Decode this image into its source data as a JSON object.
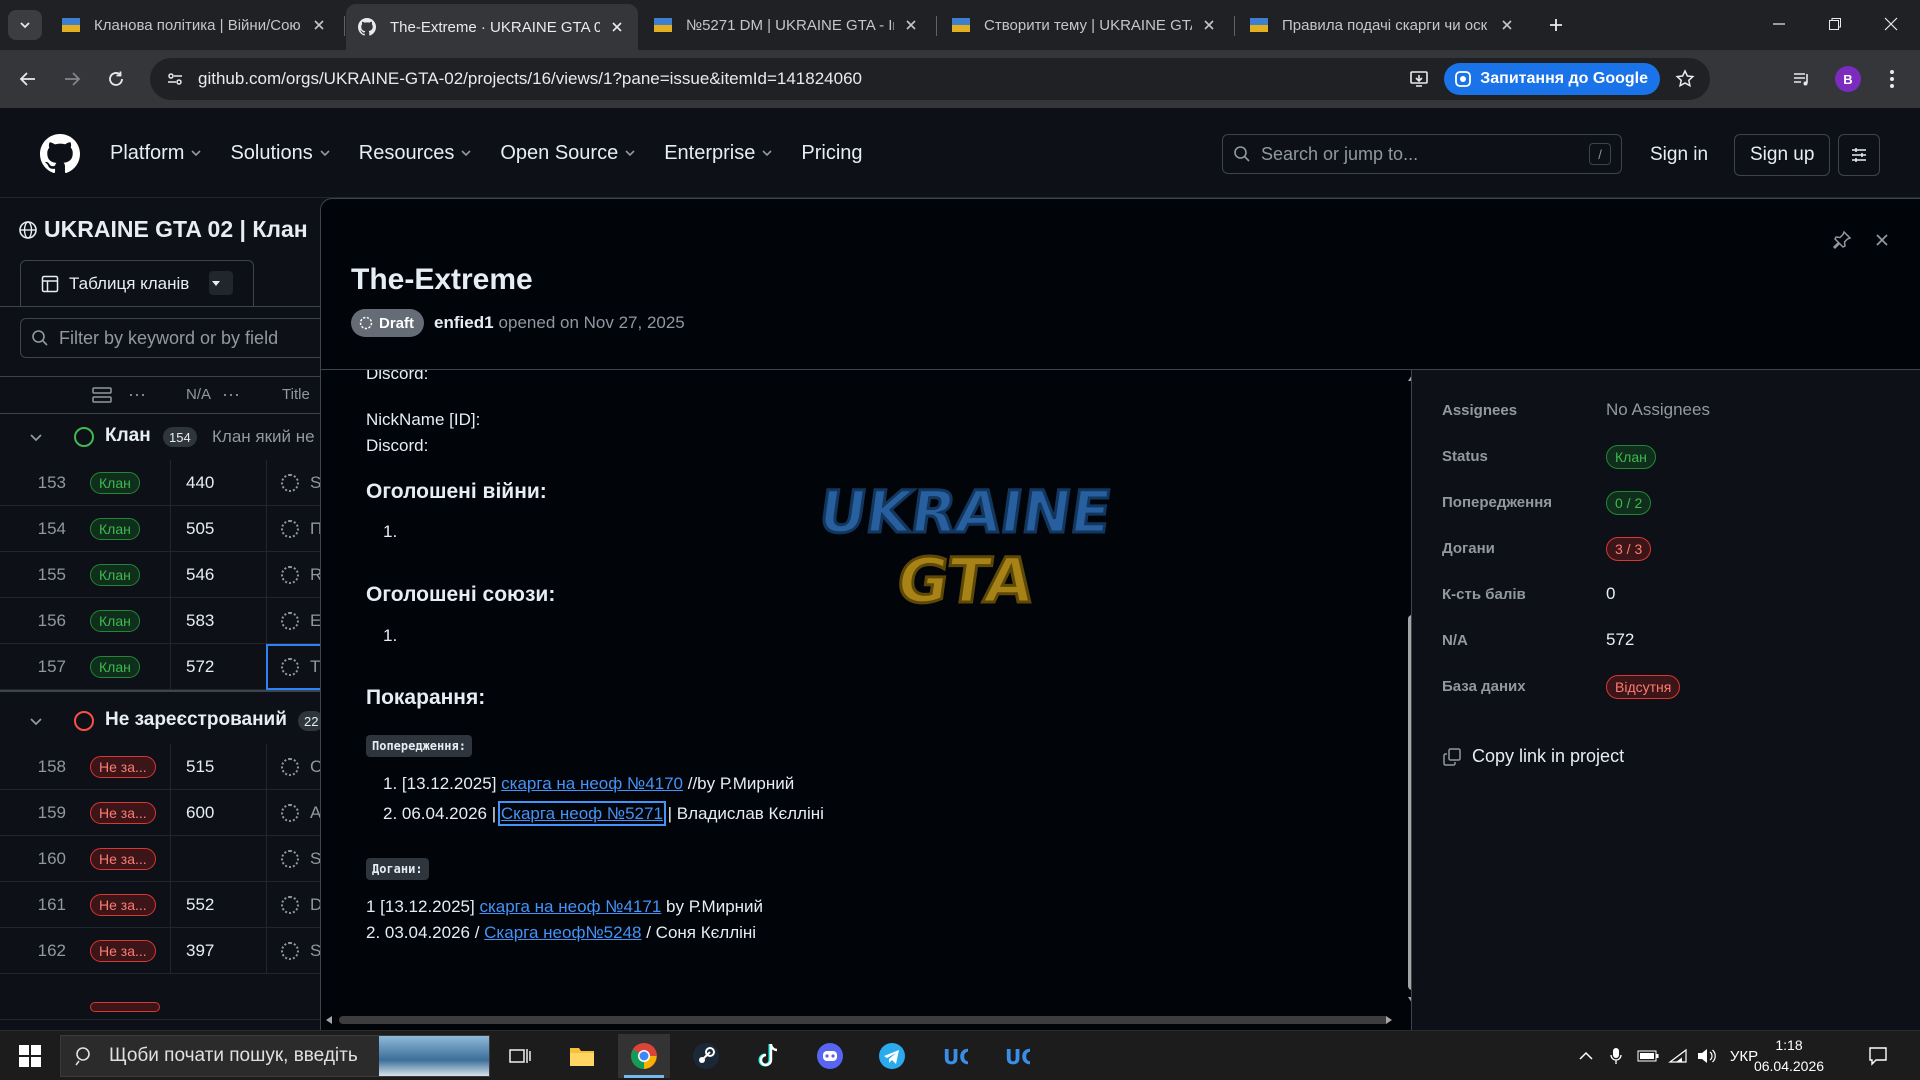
{
  "browser": {
    "tabs": [
      {
        "title": "Кланова політика | Війни/Сою",
        "active": false
      },
      {
        "title": "The-Extreme · UKRAINE GTA 02",
        "active": true
      },
      {
        "title": "№5271 DM | UKRAINE GTA - Ігр",
        "active": false
      },
      {
        "title": "Створити тему | UKRAINE GTA",
        "active": false
      },
      {
        "title": "Правила подачі скарги чи оск",
        "active": false
      }
    ],
    "url": "github.com/orgs/UKRAINE-GTA-02/projects/16/views/1?pane=issue&itemId=141824060",
    "google_button": "Запитання до Google",
    "profile_initial": "B"
  },
  "github": {
    "nav": [
      "Platform",
      "Solutions",
      "Resources",
      "Open Source",
      "Enterprise",
      "Pricing"
    ],
    "search_placeholder": "Search or jump to...",
    "search_key": "/",
    "sign_in": "Sign in",
    "sign_up": "Sign up"
  },
  "project": {
    "title": "UKRAINE GTA 02 | Клан",
    "view_tab": "Таблиця кланів",
    "filter_placeholder": "Filter by keyword or by field",
    "columns": {
      "na": "N/A",
      "title": "Title"
    },
    "groups": [
      {
        "name": "Клан",
        "count": "154",
        "description": "Клан який не",
        "status_color": "#3fb950"
      },
      {
        "name": "Не зареєстрований",
        "count": "22",
        "description": "",
        "status_color": "#f85149"
      }
    ],
    "rows_group1": [
      {
        "num": "153",
        "status": "Клан",
        "na": "440",
        "title": "S"
      },
      {
        "num": "154",
        "status": "Клан",
        "na": "505",
        "title": "П"
      },
      {
        "num": "155",
        "status": "Клан",
        "na": "546",
        "title": "R"
      },
      {
        "num": "156",
        "status": "Клан",
        "na": "583",
        "title": "E"
      },
      {
        "num": "157",
        "status": "Клан",
        "na": "572",
        "title": "T"
      }
    ],
    "rows_group2": [
      {
        "num": "158",
        "status": "Не за...",
        "na": "515",
        "title": "C"
      },
      {
        "num": "159",
        "status": "Не за...",
        "na": "600",
        "title": "A"
      },
      {
        "num": "160",
        "status": "Не за...",
        "na": "",
        "title": "S"
      },
      {
        "num": "161",
        "status": "Не за...",
        "na": "552",
        "title": "D"
      },
      {
        "num": "162",
        "status": "Не за...",
        "na": "397",
        "title": "S"
      }
    ]
  },
  "issue": {
    "title": "The-Extreme",
    "state": "Draft",
    "author": "enfied1",
    "opened": "opened on Nov 27, 2025",
    "body": {
      "discord_1": "Discord:",
      "nickname": "NickName [ID]:",
      "discord_2": "Discord:",
      "wars_heading": "Оголошені війни:",
      "wars_item": "1.",
      "alliances_heading": "Оголошені союзи:",
      "alliances_item": "1.",
      "punish_heading": "Покарання:",
      "warnings_label": "Попередження:",
      "warnings": [
        {
          "prefix": "1. [13.12.2025] ",
          "link": "скарга на неоф №4170",
          "suffix": " //by Р.Мирний"
        },
        {
          "prefix": "2. 06.04.2026 | ",
          "link": "Скарга неоф №5271",
          "suffix": " | Владислав Кєлліні"
        }
      ],
      "reprimands_label": "Догани:",
      "reprimands": [
        {
          "prefix": "1 [13.12.2025] ",
          "link": "скарга на неоф №4171",
          "suffix": " by Р.Мирний"
        },
        {
          "prefix": "2. 03.04.2026 / ",
          "link": "Скарга неоф№5248",
          "suffix": " / Соня Кєлліні"
        }
      ]
    },
    "fields": {
      "assignees": {
        "label": "Assignees",
        "value": "No Assignees"
      },
      "status": {
        "label": "Status",
        "value": "Клан"
      },
      "warnings": {
        "label": "Попередження",
        "value": "0 / 2"
      },
      "reprimands": {
        "label": "Догани",
        "value": "3 / 3"
      },
      "points": {
        "label": "К-сть балів",
        "value": "0"
      },
      "na": {
        "label": "N/A",
        "value": "572"
      },
      "database": {
        "label": "База даних",
        "value": "Відсутня"
      }
    },
    "copy_link": "Copy link in project"
  },
  "taskbar": {
    "search_placeholder": "Щоби почати пошук, введіть",
    "language": "УКР",
    "time": "1:18",
    "date": "06.04.2026"
  },
  "colors": {
    "accent": "#4493f8",
    "green": "#3fb950",
    "red": "#f85149",
    "background": "#0d1117"
  }
}
